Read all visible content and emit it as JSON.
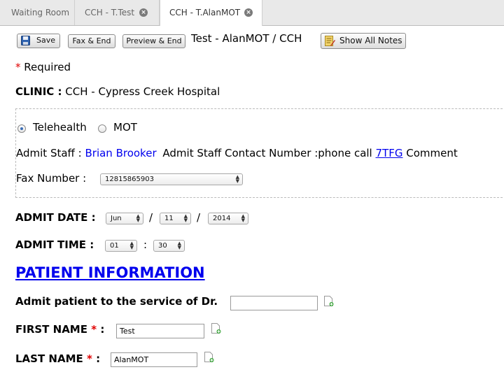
{
  "tabs": [
    {
      "label": "Waiting Room"
    },
    {
      "label": "CCH - T.Test"
    },
    {
      "label": "CCH - T.AlanMOT"
    }
  ],
  "toolbar": {
    "save_label": "Save",
    "fax_end_label": "Fax & End",
    "preview_end_label": "Preview & End",
    "title": "Test - AlanMOT / CCH",
    "show_notes_label": "Show All Notes"
  },
  "required": {
    "star": "*",
    "text": "Required"
  },
  "clinic": {
    "label": "CLINIC :",
    "value": "CCH - Cypress Creek Hospital"
  },
  "visit_type": {
    "option1": "Telehealth",
    "option2": "MOT",
    "selected": "Telehealth"
  },
  "admit_staff": {
    "label": "Admit Staff :",
    "name": "Brian Brooker",
    "contact_label": "Admit Staff Contact Number :phone call",
    "contact_link": "7TFG",
    "comment_label": "Comment"
  },
  "fax": {
    "label": "Fax Number :",
    "value": "12815865903"
  },
  "admit_date": {
    "label": "ADMIT DATE :",
    "month": "Jun",
    "day": "11",
    "year": "2014",
    "sep": "/"
  },
  "admit_time": {
    "label": "ADMIT TIME :",
    "hour": "01",
    "minute": "30",
    "sep": ":"
  },
  "patient_info": {
    "heading": "PATIENT INFORMATION",
    "service_label": "Admit patient to the service of Dr.",
    "service_value": "",
    "first_name_label": "FIRST NAME",
    "first_name_value": "Test",
    "last_name_label": "LAST NAME",
    "last_name_value": "AlanMOT",
    "star": "*",
    "colon": ":"
  },
  "colors": {
    "link": "#0000ee",
    "heading": "#0000ee",
    "required": "#e00000",
    "radio": "#3a6db5"
  }
}
